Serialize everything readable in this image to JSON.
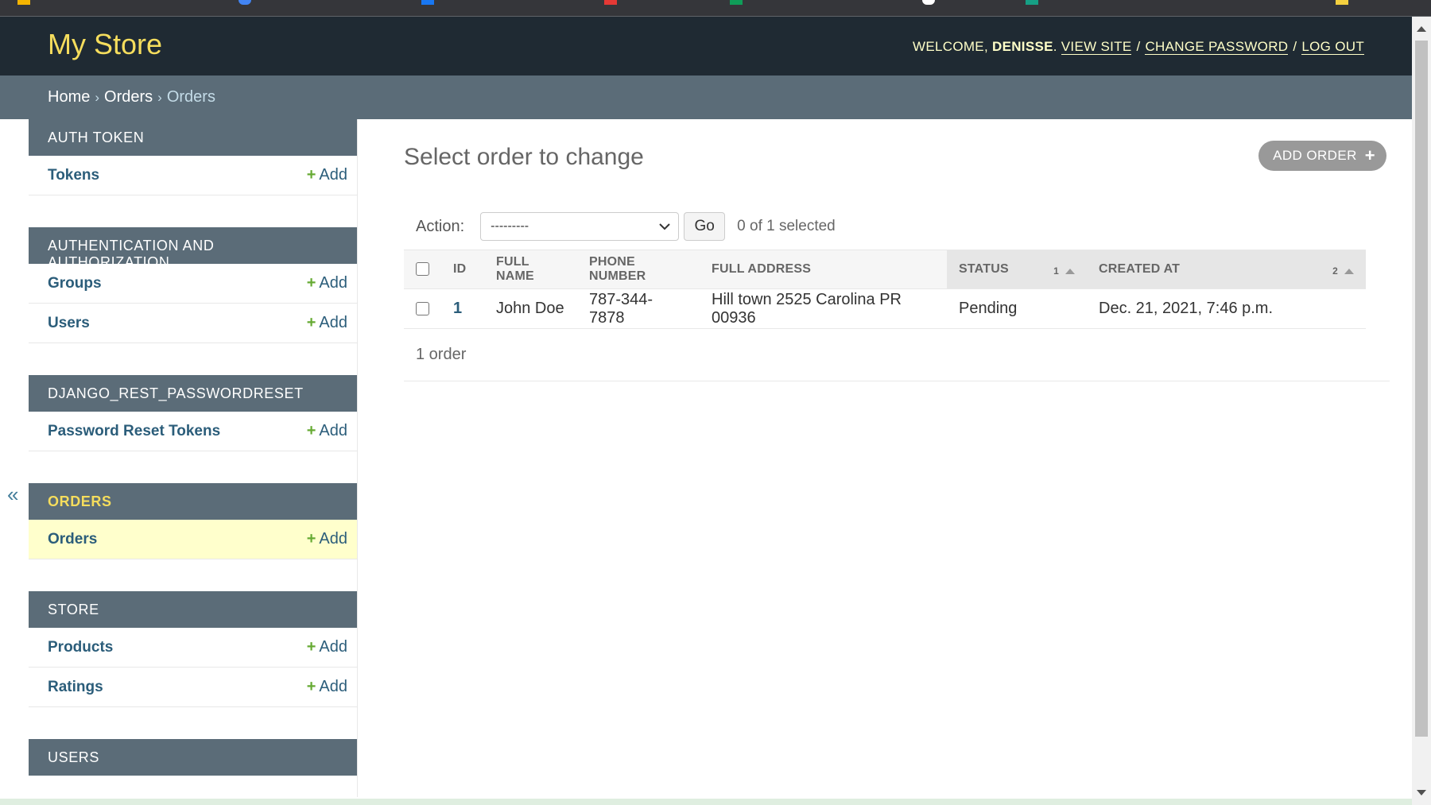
{
  "header": {
    "site_name": "My Store",
    "welcome": "WELCOME,",
    "username": "DENISSE",
    "links": {
      "view_site": "VIEW SITE",
      "change_password": "CHANGE PASSWORD",
      "log_out": "LOG OUT"
    },
    "separator": "/"
  },
  "breadcrumbs": {
    "home": "Home",
    "app": "Orders",
    "current": "Orders",
    "arrow": "›"
  },
  "sidebar": {
    "add_label": "Add",
    "add_icon": "plus-icon",
    "collapse_icon": "«",
    "modules": [
      {
        "caption": "AUTH TOKEN",
        "models": [
          "Tokens"
        ]
      },
      {
        "caption": "AUTHENTICATION AND AUTHORIZATION",
        "models": [
          "Groups",
          "Users"
        ]
      },
      {
        "caption": "DJANGO_REST_PASSWORDRESET",
        "models": [
          "Password Reset Tokens"
        ]
      },
      {
        "caption": "ORDERS",
        "models": [
          "Orders"
        ],
        "current": true
      },
      {
        "caption": "STORE",
        "models": [
          "Products",
          "Ratings"
        ]
      },
      {
        "caption": "USERS",
        "models": []
      }
    ]
  },
  "main": {
    "title": "Select order to change",
    "add_button": "ADD ORDER",
    "action_label": "Action:",
    "action_selected": "---------",
    "go_button": "Go",
    "selection_count": "0 of 1 selected",
    "columns": [
      "ID",
      "FULL NAME",
      "PHONE NUMBER",
      "FULL ADDRESS",
      "STATUS",
      "CREATED AT"
    ],
    "sort_priority": {
      "status": "1",
      "created_at": "2"
    },
    "rows": [
      {
        "id": "1",
        "full_name": "John Doe",
        "phone": "787-344-7878",
        "address": "Hill town 2525 Carolina PR 00936",
        "status": "Pending",
        "created_at": "Dec. 21, 2021, 7:46 p.m."
      }
    ],
    "paginator": "1 order"
  },
  "colors": {
    "header_bg": "#1f2a33",
    "branding": "#f5dd5d",
    "breadcrumb_bg": "#5b6c78",
    "module_caption_bg": "#5b6c78",
    "link": "#2b5d7a",
    "add_green": "#66aa33",
    "current_row": "#ffffcc"
  }
}
